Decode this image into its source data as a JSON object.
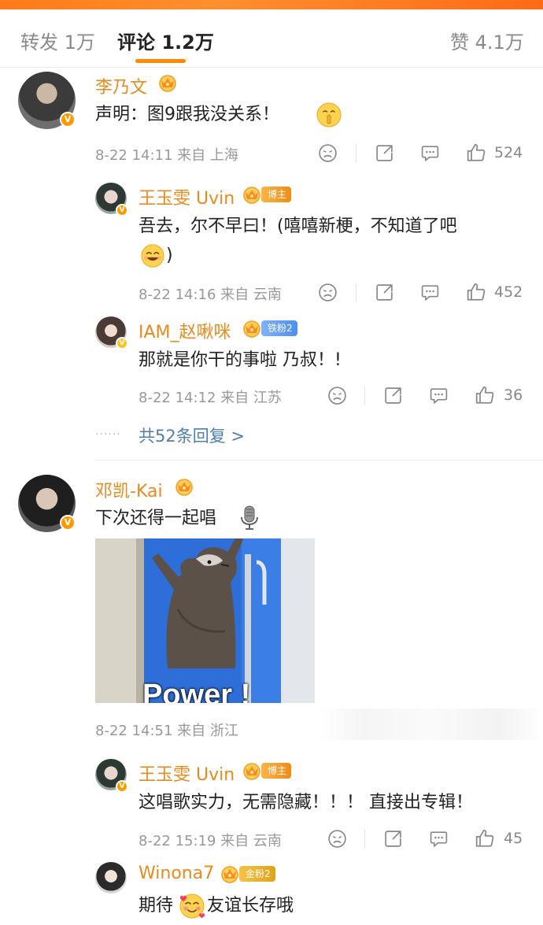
{
  "tabs": {
    "repost": "转发 1万",
    "comments": "评论 1.2万",
    "likes": "赞 4.1万"
  },
  "colors": {
    "accent": "#ff8a00",
    "name": "#e98a1c",
    "link": "#4f7eb5"
  },
  "comments": [
    {
      "user": "李乃文",
      "text": "声明：图9跟我没关系！",
      "time": "8-22 14:11 来自 上海",
      "likes": "524",
      "replies": [
        {
          "user": "王玉雯 Uvin",
          "badge": "博主",
          "text_line1": "吾去，尔不早曰！(嘻嘻新梗，不知道了吧",
          "text_line2": ")",
          "time": "8-22 14:16 来自 云南",
          "likes": "452"
        },
        {
          "user": "IAM_赵啾咪",
          "badge": "铁粉2",
          "text": "那就是你干的事啦 乃叔！!",
          "time": "8-22 14:12 来自 江苏",
          "likes": "36"
        }
      ],
      "more_replies": "共52条回复 >"
    },
    {
      "user": "邓凯-Kai",
      "text": "下次还得一起唱",
      "image_caption": "Power !",
      "time": "8-22 14:51 来自 浙江",
      "replies": [
        {
          "user": "王玉雯 Uvin",
          "badge": "博主",
          "text": "这唱歌实力，无需隐藏！！！ 直接出专辑！",
          "time": "8-22 15:19 来自 云南",
          "likes": "45"
        },
        {
          "user": "Winona7",
          "badge": "金粉2",
          "text_before": "期待",
          "text_after": "友谊长存哦"
        }
      ]
    }
  ],
  "icons": [
    "crown-icon",
    "dislike-icon",
    "share-icon",
    "comment-icon",
    "like-icon",
    "microphone-icon",
    "smile-emoji-icon",
    "shush-emoji-icon",
    "love-emoji-icon"
  ]
}
